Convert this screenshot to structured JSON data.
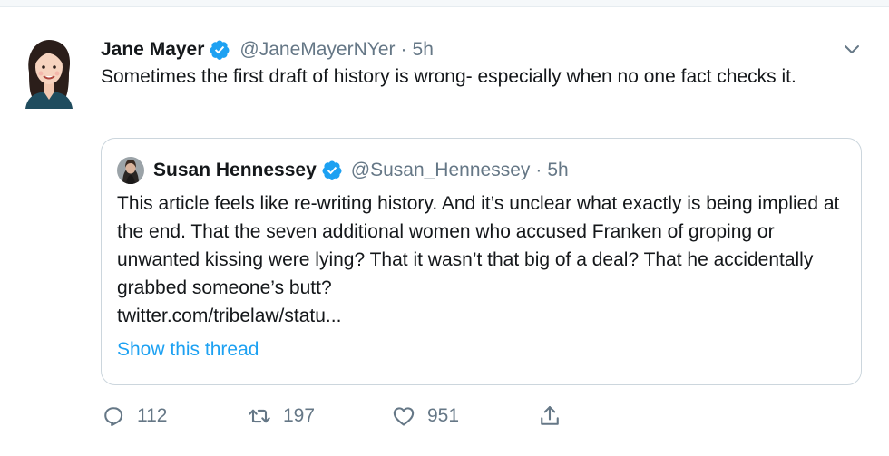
{
  "tweet": {
    "author_name": "Jane Mayer",
    "author_handle": "@JaneMayerNYer",
    "separator": "·",
    "time": "5h",
    "text": "Sometimes the first draft of history is wrong- especially when no one fact checks it."
  },
  "quoted": {
    "author_name": "Susan Hennessey",
    "author_handle": "@Susan_Hennessey",
    "separator": "·",
    "time": "5h",
    "text": "This article feels like re-writing history. And it’s unclear what exactly is being implied at the end. That the seven additional women who accused Franken of groping or unwanted kissing were lying? That it wasn’t that big of a deal? That he accidentally grabbed someone’s butt?",
    "link": "twitter.com/tribelaw/statu...",
    "show_thread": "Show this thread"
  },
  "actions": {
    "replies": "112",
    "retweets": "197",
    "likes": "951"
  },
  "icons": {
    "verified": "verified-badge-icon",
    "menu": "chevron-down-icon",
    "reply": "reply-icon",
    "retweet": "retweet-icon",
    "like": "heart-icon",
    "share": "share-icon"
  },
  "colors": {
    "accent": "#1da1f2",
    "muted": "#657786",
    "text": "#14171a",
    "border": "#ccd6dd"
  }
}
